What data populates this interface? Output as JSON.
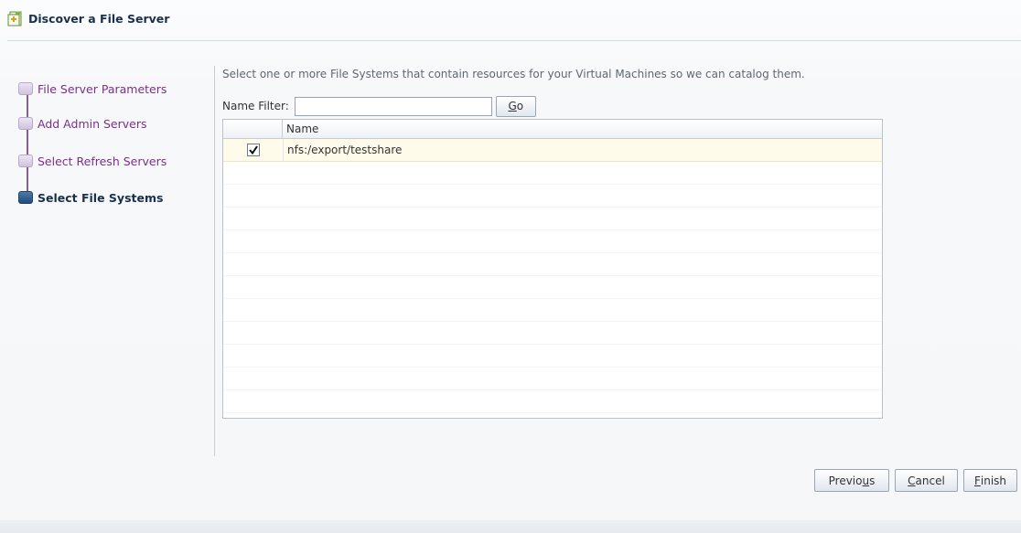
{
  "dialog": {
    "title": "Discover a File Server",
    "title_icon": "file-server-wizard-icon"
  },
  "train": {
    "steps": [
      {
        "label": "File Server Parameters",
        "state": "visited"
      },
      {
        "label": "Add Admin Servers",
        "state": "visited"
      },
      {
        "label": "Select Refresh Servers",
        "state": "visited"
      },
      {
        "label": "Select File Systems",
        "state": "current"
      }
    ]
  },
  "main": {
    "instruction": "Select one or more File Systems that contain resources for your Virtual Machines so we can catalog them.",
    "filter": {
      "label": "Name Filter:",
      "value": "",
      "placeholder": ""
    },
    "go_button": {
      "mnemonic": "G",
      "rest": "o"
    },
    "table": {
      "columns": [
        "",
        "Name"
      ],
      "rows": [
        {
          "checked": true,
          "name": "nfs:/export/testshare"
        }
      ]
    }
  },
  "footer": {
    "previous": {
      "pre": "Previo",
      "mnemonic": "u",
      "post": "s"
    },
    "cancel": {
      "pre": "",
      "mnemonic": "C",
      "post": "ancel"
    },
    "finish": {
      "pre": "",
      "mnemonic": "F",
      "post": "inish"
    }
  },
  "colors": {
    "title": "#18304d",
    "visited_step": "#7c2f8a",
    "current_step": "#214c7b",
    "selected_row": "#fffbea"
  }
}
